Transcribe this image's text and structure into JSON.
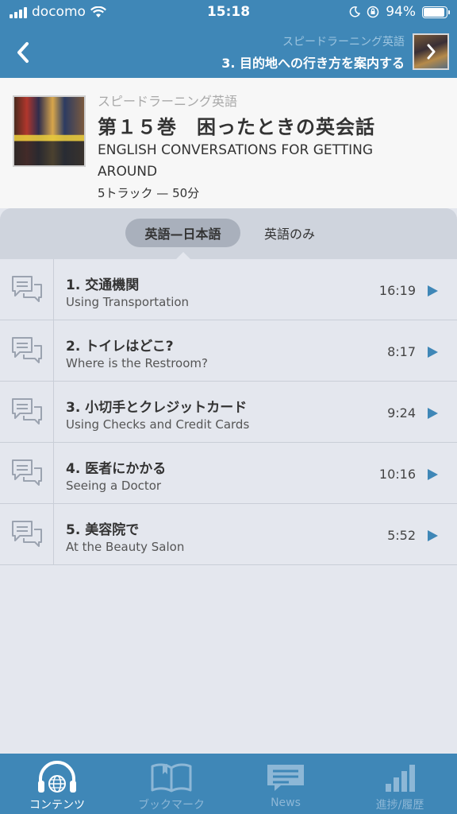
{
  "status": {
    "carrier": "docomo",
    "time": "15:18",
    "battery": "94%",
    "battery_level": 0.94
  },
  "nav": {
    "back_icon": "chevron-left-icon",
    "series": "スピードラーニング英語",
    "current_track": "3. 目的地への行き方を案内する",
    "thumb_icon": "chevron-right-icon"
  },
  "album": {
    "series": "スピードラーニング英語",
    "title": "第１５巻　困ったときの英会話",
    "title_en": "ENGLISH CONVERSATIONS FOR GETTING AROUND",
    "meta": "5トラック — 50分"
  },
  "segments": {
    "active": "英語—日本語",
    "inactive": "英語のみ"
  },
  "tracks": [
    {
      "title": "1. 交通機関",
      "subtitle": "Using Transportation",
      "duration": "16:19"
    },
    {
      "title": "2. トイレはどこ?",
      "subtitle": "Where is the Restroom?",
      "duration": "8:17"
    },
    {
      "title": "3. 小切手とクレジットカード",
      "subtitle": "Using Checks and Credit Cards",
      "duration": "9:24"
    },
    {
      "title": "4. 医者にかかる",
      "subtitle": "Seeing a Doctor",
      "duration": "10:16"
    },
    {
      "title": "5. 美容院で",
      "subtitle": "At the Beauty Salon",
      "duration": "5:52"
    }
  ],
  "tabs": [
    {
      "label": "コンテンツ",
      "icon": "headphones-globe-icon",
      "active": true
    },
    {
      "label": "ブックマーク",
      "icon": "book-icon",
      "active": false
    },
    {
      "label": "News",
      "icon": "news-icon",
      "active": false
    },
    {
      "label": "進捗/履歴",
      "icon": "bar-chart-icon",
      "active": false
    }
  ],
  "colors": {
    "accent": "#3f87b7",
    "background": "#e4e7ee"
  }
}
